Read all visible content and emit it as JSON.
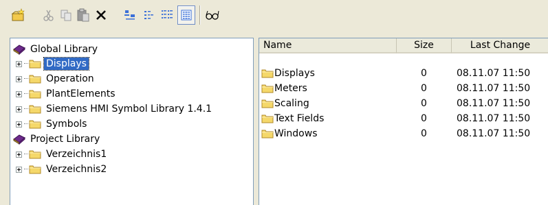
{
  "toolbar": {
    "buttons": [
      {
        "icon": "new-folder-icon"
      },
      {
        "icon": "cut-icon"
      },
      {
        "icon": "copy-icon"
      },
      {
        "icon": "paste-icon"
      },
      {
        "icon": "delete-icon"
      },
      {
        "icon": "large-icons-view-icon"
      },
      {
        "icon": "small-icons-view-icon"
      },
      {
        "icon": "list-view-icon"
      },
      {
        "icon": "details-view-icon",
        "pressed": true
      },
      {
        "icon": "glasses-icon"
      }
    ]
  },
  "tree": {
    "global_library": {
      "label": "Global Library",
      "children": [
        "Displays",
        "Operation",
        "PlantElements",
        "Siemens HMI Symbol Library 1.4.1",
        "Symbols"
      ],
      "selected": "Displays"
    },
    "project_library": {
      "label": "Project Library",
      "children": [
        "Verzeichnis1",
        "Verzeichnis2"
      ]
    }
  },
  "list": {
    "columns": [
      "Name",
      "Size",
      "Last Change"
    ],
    "rows": [
      {
        "name": "Displays",
        "size": "0",
        "last_change": "08.11.07 11:50"
      },
      {
        "name": "Meters",
        "size": "0",
        "last_change": "08.11.07 11:50"
      },
      {
        "name": "Scaling",
        "size": "0",
        "last_change": "08.11.07 11:50"
      },
      {
        "name": "Text Fields",
        "size": "0",
        "last_change": "08.11.07 11:50"
      },
      {
        "name": "Windows",
        "size": "0",
        "last_change": "08.11.07 11:50"
      }
    ]
  },
  "colors": {
    "window_bg": "#ece9d8",
    "selection": "#316ac5",
    "folder": "#f5d86a",
    "book": "#6d2a8c"
  }
}
